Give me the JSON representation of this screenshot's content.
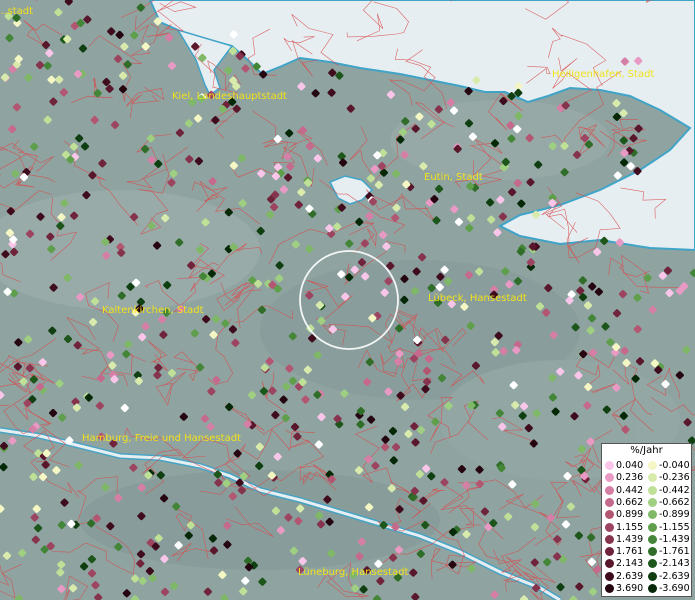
{
  "colors": {
    "water": "#e6eef2",
    "land": "#8fa3a1",
    "border": "#d94a4a",
    "label": "#f2e21a"
  },
  "cities": [
    {
      "name": "...stadt"
    },
    {
      "name": "Kiel, Landeshauptstadt"
    },
    {
      "name": "Heiligenhafen, Stadt"
    },
    {
      "name": "Eutin, Stadt"
    },
    {
      "name": "Kaltenkirchen, Stadt"
    },
    {
      "name": "Lübeck, Hansestadt"
    },
    {
      "name": "Hamburg, Freie und Hansestadt"
    },
    {
      "name": "Lüneburg, Hansestadt"
    }
  ],
  "legend": {
    "title": "%/Jahr",
    "positive": [
      {
        "label": "0.040",
        "color": "#f9c6ea"
      },
      {
        "label": "0.236",
        "color": "#e89ac4"
      },
      {
        "label": "0.442",
        "color": "#d67fa6"
      },
      {
        "label": "0.662",
        "color": "#c56a8c"
      },
      {
        "label": "0.899",
        "color": "#b25672"
      },
      {
        "label": "1.155",
        "color": "#9d4560"
      },
      {
        "label": "1.439",
        "color": "#86334d"
      },
      {
        "label": "1.761",
        "color": "#6f243b"
      },
      {
        "label": "2.143",
        "color": "#58172b"
      },
      {
        "label": "2.639",
        "color": "#3e0c1c"
      },
      {
        "label": "3.690",
        "color": "#240510"
      }
    ],
    "negative": [
      {
        "label": "-0.040",
        "color": "#f4f6c4"
      },
      {
        "label": "-0.236",
        "color": "#d9ebac"
      },
      {
        "label": "-0.442",
        "color": "#bfe097"
      },
      {
        "label": "-0.662",
        "color": "#9fcf80"
      },
      {
        "label": "-0.899",
        "color": "#7fb866"
      },
      {
        "label": "-1.155",
        "color": "#5f9f4c"
      },
      {
        "label": "-1.439",
        "color": "#448638"
      },
      {
        "label": "-1.761",
        "color": "#2f6d28"
      },
      {
        "label": "-2.143",
        "color": "#1d561b"
      },
      {
        "label": "-2.639",
        "color": "#0f3f10"
      },
      {
        "label": "-3.690",
        "color": "#052806"
      }
    ]
  }
}
